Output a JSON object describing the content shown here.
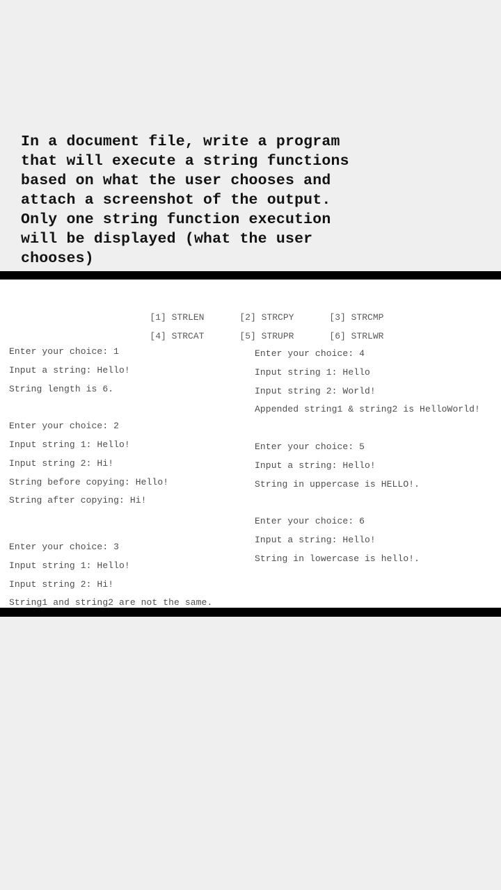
{
  "prompt": {
    "lines": [
      "In a document file, write a program",
      "that will execute a string functions",
      "based on what the user chooses and",
      "attach a screenshot of the output.",
      "Only one string function execution",
      "will be displayed (what the user",
      "chooses)"
    ]
  },
  "colors": {
    "page_background": "#efefef",
    "console_background": "#ffffff",
    "separator_bar": "#000000",
    "prompt_text": "#121212",
    "console_text": "#4d4d4d",
    "menu_text": "#5a5a5a"
  },
  "console": {
    "menu": {
      "rows": [
        [
          {
            "key": "[1]",
            "label": "STRLEN"
          },
          {
            "key": "[2]",
            "label": "STRCPY"
          },
          {
            "key": "[3]",
            "label": "STRCMP"
          }
        ],
        [
          {
            "key": "[4]",
            "label": "STRCAT"
          },
          {
            "key": "[5]",
            "label": "STRUPR"
          },
          {
            "key": "[6]",
            "label": "STRLWR"
          }
        ]
      ]
    },
    "left_column": {
      "blocks": [
        {
          "choice": "1",
          "lines": [
            "Enter your choice: 1",
            "Input a string: Hello!",
            "String length is 6."
          ]
        },
        {
          "choice": "2",
          "lines": [
            "Enter your choice: 2",
            "Input string 1: Hello!",
            "Input string 2: Hi!",
            "String before copying: Hello!",
            "String after copying: Hi!"
          ]
        },
        {
          "choice": "3",
          "lines": [
            "Enter your choice: 3",
            "Input string 1: Hello!",
            "Input string 2: Hi!",
            "String1 and string2 are not the same."
          ]
        }
      ]
    },
    "right_column": {
      "blocks": [
        {
          "choice": "4",
          "lines": [
            "Enter your choice: 4",
            "Input string 1: Hello",
            "Input string 2: World!",
            "Appended string1 & string2 is HelloWorld!"
          ]
        },
        {
          "choice": "5",
          "lines": [
            "Enter your choice: 5",
            "Input a string: Hello!",
            "String in uppercase is HELLO!."
          ]
        },
        {
          "choice": "6",
          "lines": [
            "Enter your choice: 6",
            "Input a string: Hello!",
            "String in lowercase is hello!."
          ]
        }
      ]
    }
  }
}
